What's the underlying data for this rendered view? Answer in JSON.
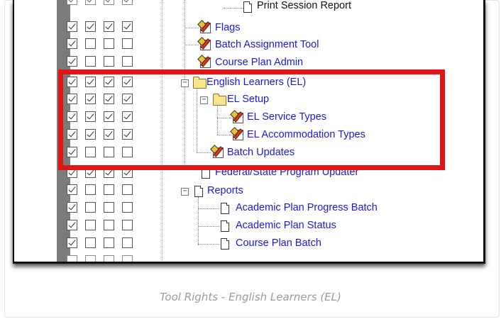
{
  "caption": "Tool Rights - English Learners (EL)",
  "colors": {
    "highlight_border": "#e01515",
    "link": "#1a1ad6",
    "caption": "#9b9b9b"
  },
  "tree": [
    {
      "label": "Print Session Report",
      "icon": "doc-icon",
      "checks": [
        true,
        true,
        true,
        true
      ]
    },
    {
      "label": "Flags",
      "icon": "edit-icon",
      "checks": [
        true,
        true,
        true,
        true
      ]
    },
    {
      "label": "Batch Assignment Tool",
      "icon": "edit-icon",
      "checks": [
        true,
        false,
        false,
        false
      ]
    },
    {
      "label": "Course Plan Admin",
      "icon": "edit-icon",
      "checks": [
        true,
        false,
        false,
        false
      ]
    },
    {
      "label": "English Learners (EL)",
      "icon": "folder-icon",
      "checks": [
        true,
        true,
        true,
        true
      ]
    },
    {
      "label": "EL Setup",
      "icon": "folder-icon",
      "checks": [
        true,
        true,
        true,
        true
      ]
    },
    {
      "label": "EL Service Types",
      "icon": "edit-icon",
      "checks": [
        true,
        true,
        true,
        true
      ]
    },
    {
      "label": "EL Accommodation Types",
      "icon": "edit-icon",
      "checks": [
        true,
        true,
        true,
        true
      ]
    },
    {
      "label": "Batch Updates",
      "icon": "edit-icon",
      "checks": [
        true,
        false,
        false,
        false
      ]
    },
    {
      "label": "Federal/State Program Updater",
      "icon": "doc-icon",
      "checks": [
        true,
        true,
        true,
        true
      ]
    },
    {
      "label": "Reports",
      "icon": "doc-icon",
      "checks": [
        true,
        false,
        false,
        false
      ]
    },
    {
      "label": "Academic Plan Progress Batch",
      "icon": "doc-icon",
      "checks": [
        true,
        false,
        false,
        false
      ]
    },
    {
      "label": "Academic Plan Status",
      "icon": "doc-icon",
      "checks": [
        true,
        false,
        false,
        false
      ]
    },
    {
      "label": "Course Plan Batch",
      "icon": "doc-icon",
      "checks": [
        true,
        false,
        false,
        false
      ]
    }
  ]
}
